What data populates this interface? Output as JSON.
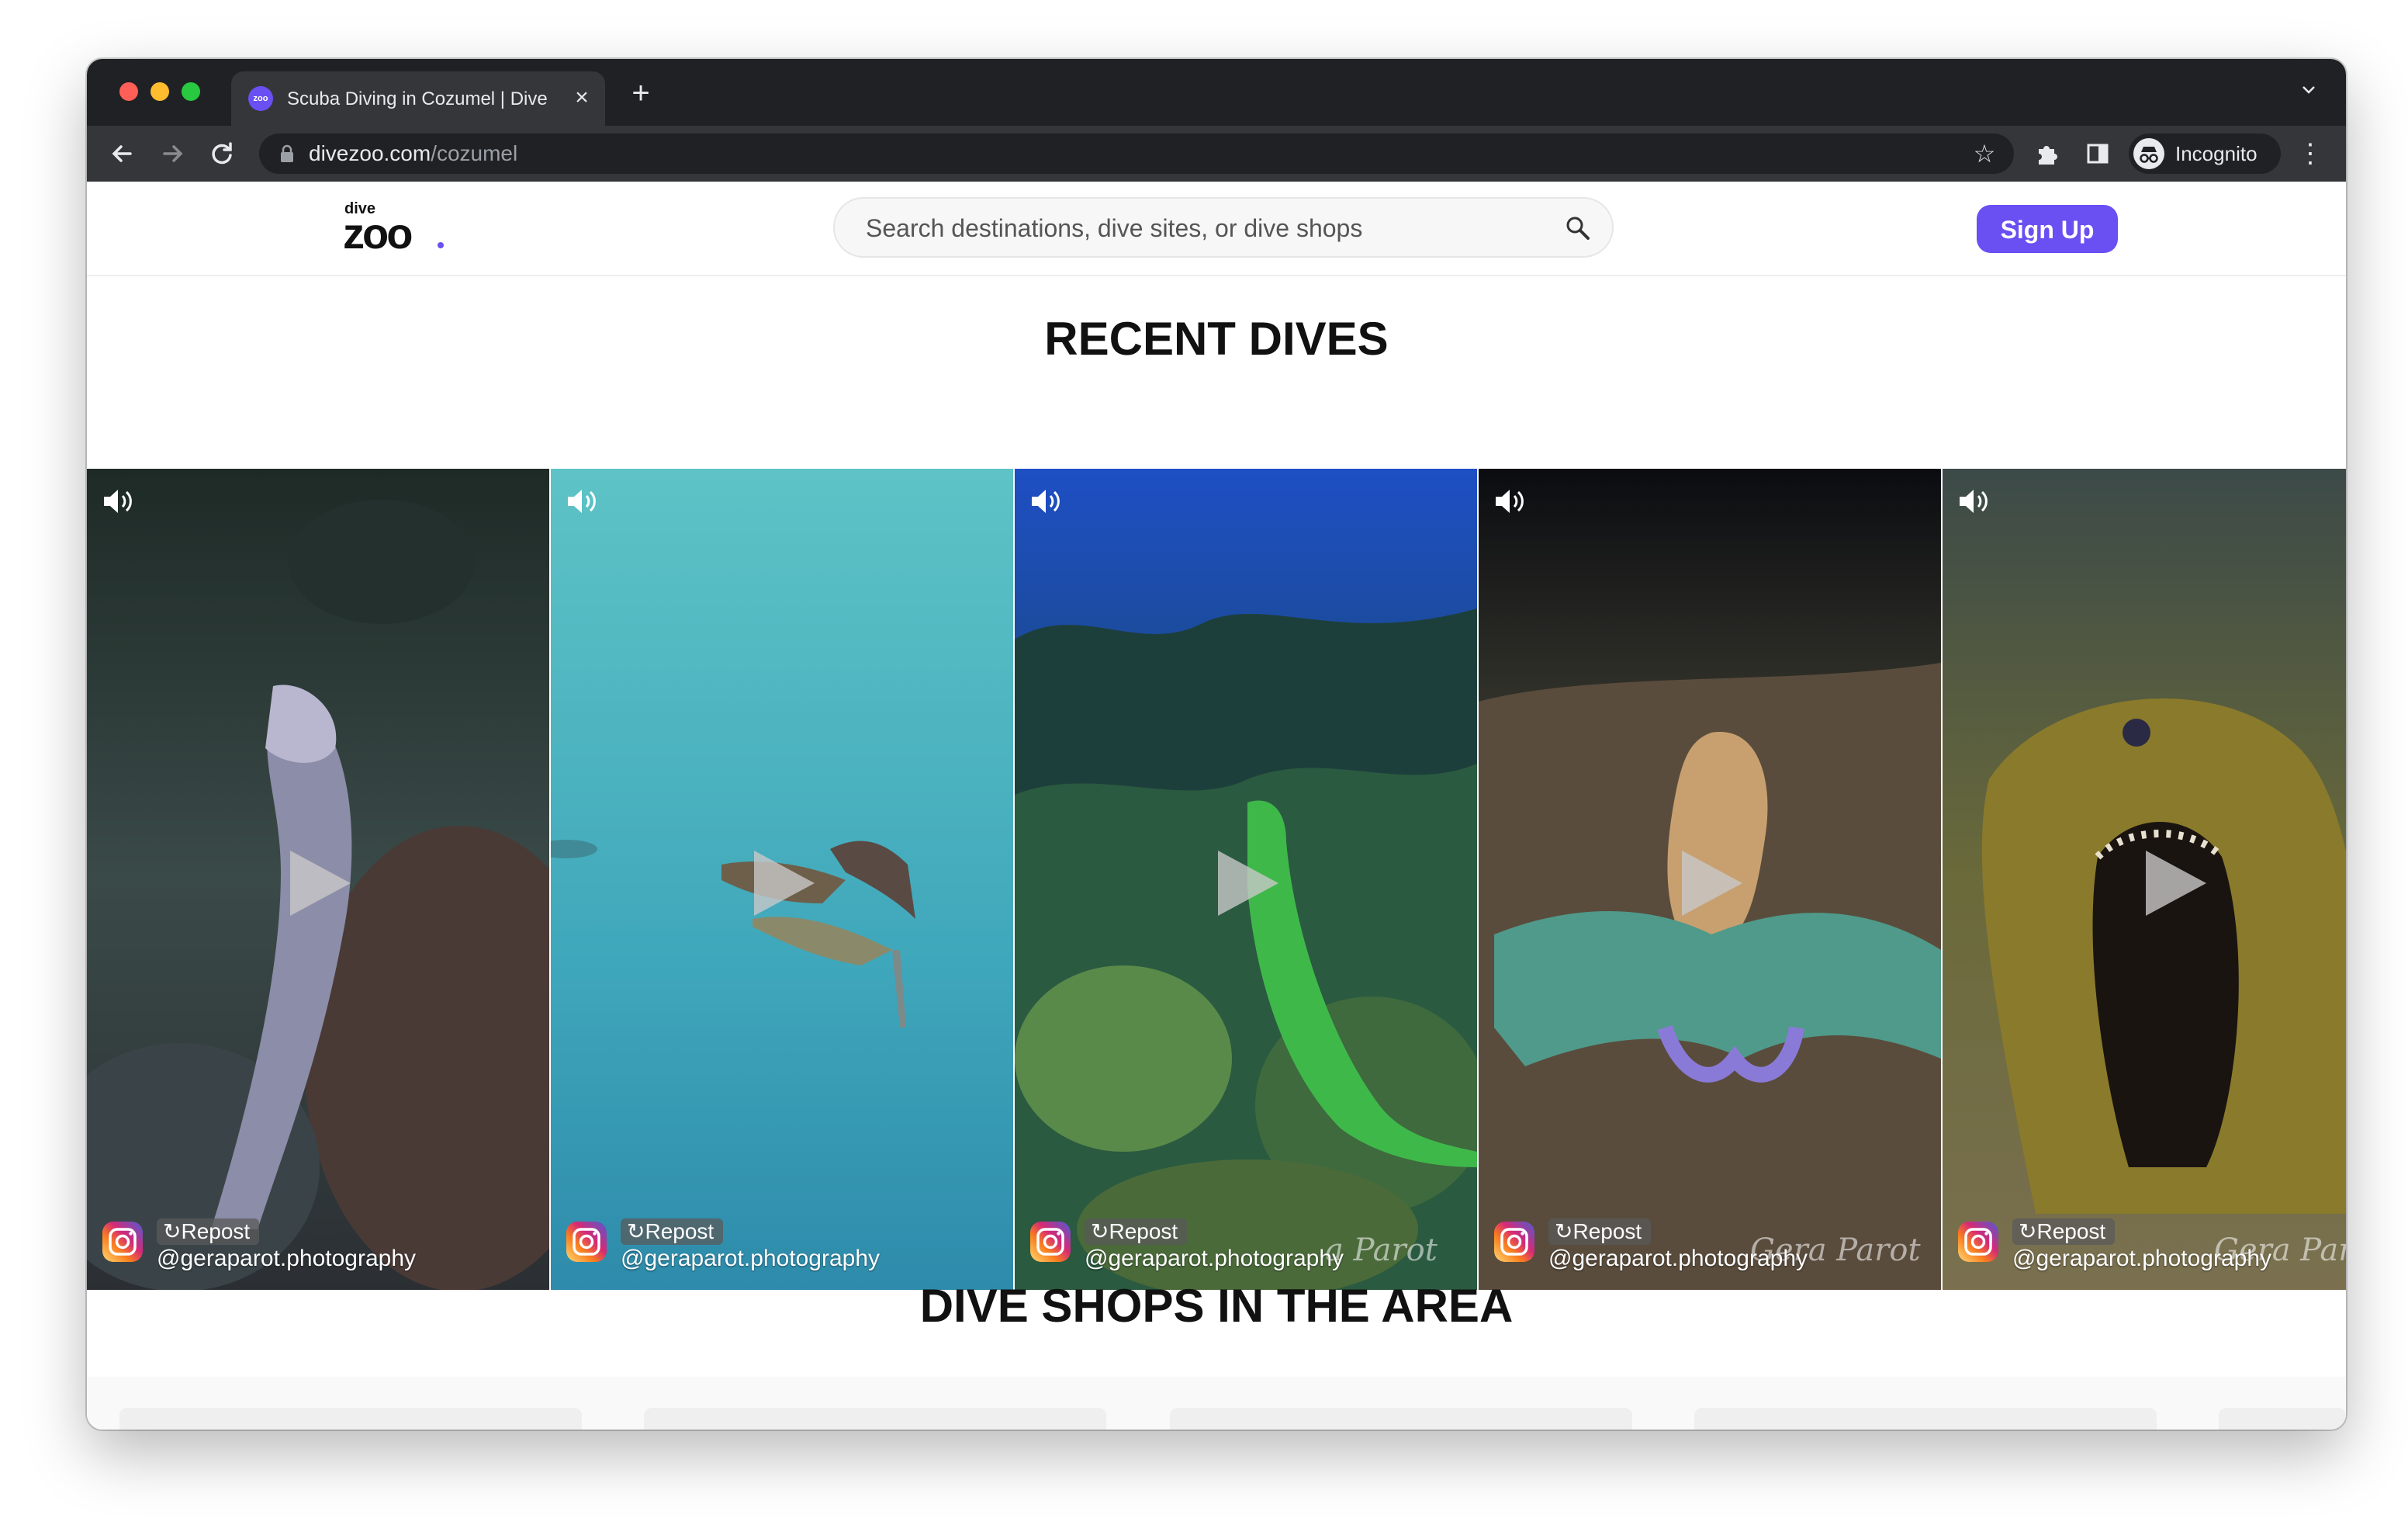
{
  "browser": {
    "tab_title": "Scuba Diving in Cozumel | Dive",
    "favicon_text": "zoo",
    "url_host": "divezoo.com",
    "url_path": "/cozumel",
    "profile_label": "Incognito"
  },
  "header": {
    "logo_top": "dive",
    "logo_main": "zoo",
    "search_placeholder": "Search destinations, dive sites, or dive shops",
    "signup_label": "Sign Up",
    "accent_color": "#6a4ff2"
  },
  "recent_dives": {
    "title": "RECENT DIVES",
    "videos": [
      {
        "subject": "spotted moray eel",
        "repost_label": "Repost",
        "handle": "@geraparot.photography",
        "watermark": ""
      },
      {
        "subject": "squid pair",
        "repost_label": "Repost",
        "handle": "@geraparot.photography",
        "watermark": ""
      },
      {
        "subject": "green sea slug on reef",
        "repost_label": "Repost",
        "handle": "@geraparot.photography",
        "watermark": "a Parot"
      },
      {
        "subject": "octopus",
        "repost_label": "Repost",
        "handle": "@geraparot.photography",
        "watermark": "Gera Parot"
      },
      {
        "subject": "green moray open mouth",
        "repost_label": "Repost",
        "handle": "@geraparot.photography",
        "watermark": "Gera Parot"
      }
    ]
  },
  "dive_shops": {
    "title": "DIVE SHOPS IN THE AREA"
  }
}
